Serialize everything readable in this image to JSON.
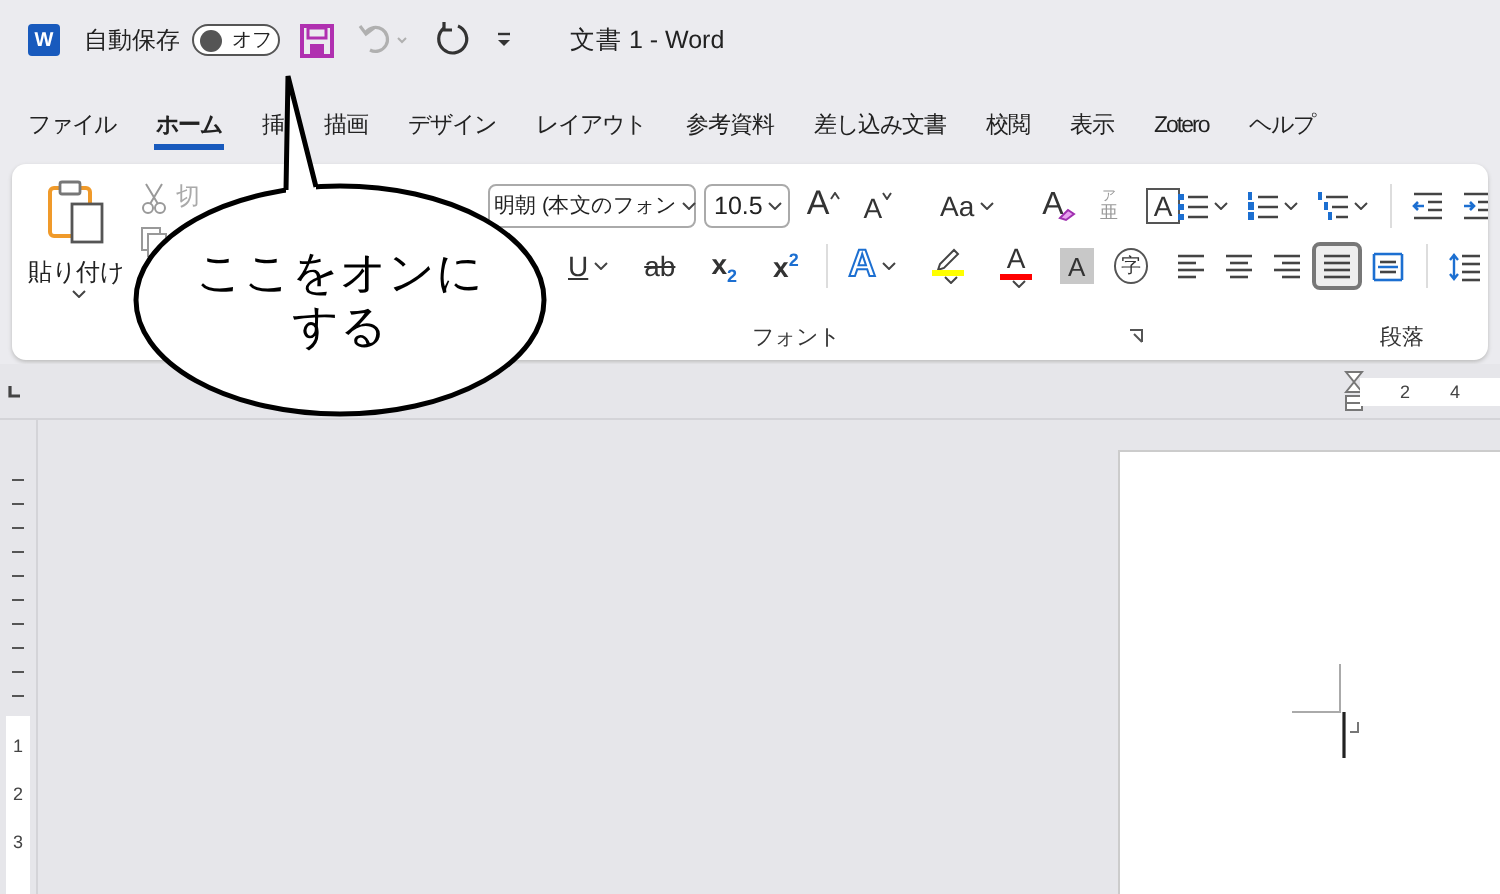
{
  "titlebar": {
    "app_letter": "W",
    "autosave_label": "自動保存",
    "autosave": {
      "on": false,
      "label": "オフ"
    },
    "quick_access": [
      {
        "kind": "save",
        "disabled": false
      },
      {
        "kind": "undo",
        "disabled": true
      },
      {
        "kind": "redo",
        "disabled": false
      },
      {
        "kind": "customize",
        "disabled": false
      }
    ],
    "title": "文書 1  -  Word"
  },
  "tabs": [
    {
      "label": "ファイル",
      "selected": false
    },
    {
      "label": "ホーム",
      "selected": true
    },
    {
      "label": "挿",
      "selected": false
    },
    {
      "label": "描画",
      "selected": false
    },
    {
      "label": "デザイン",
      "selected": false
    },
    {
      "label": "レイアウト",
      "selected": false
    },
    {
      "label": "参考資料",
      "selected": false
    },
    {
      "label": "差し込み文書",
      "selected": false
    },
    {
      "label": "校閲",
      "selected": false
    },
    {
      "label": "表示",
      "selected": false
    },
    {
      "label": "Zotero",
      "selected": false
    },
    {
      "label": "ヘルプ",
      "selected": false
    }
  ],
  "ribbon": {
    "clipboard": {
      "paste_label": "貼り付け",
      "cut_label": "切"
    },
    "font": {
      "font_name": "明朝 (本文のフォン",
      "font_size": "10.5",
      "row1": [
        [
          {
            "kind": "grow",
            "glyph": "A",
            "dropdown": false
          },
          {
            "kind": "shrink",
            "glyph": "A",
            "dropdown": false
          }
        ],
        [
          {
            "kind": "case",
            "glyph": "Aa",
            "dropdown": true
          }
        ],
        [
          {
            "kind": "clear",
            "glyph": "A",
            "dropdown": false
          },
          {
            "kind": "ruby",
            "glyph": "亜",
            "ruby": "ア",
            "dropdown": false
          },
          {
            "kind": "boxed",
            "glyph": "A",
            "dropdown": false
          }
        ]
      ],
      "row2": [
        [
          {
            "kind": "underline",
            "glyph": "U",
            "dropdown": true
          },
          {
            "kind": "strike",
            "glyph": "ab",
            "dropdown": false
          },
          {
            "kind": "sub",
            "glyph": "x$_{2}$",
            "dropdown": false
          },
          {
            "kind": "sup",
            "glyph": "x$^{2}$",
            "dropdown": false
          }
        ],
        [
          {
            "kind": "effects",
            "glyph": "A",
            "dropdown": true
          },
          {
            "kind": "highlight",
            "color": "#ffff00",
            "dropdown": true
          },
          {
            "kind": "fontcolor",
            "glyph": "A",
            "color": "#ff0000",
            "dropdown": true
          },
          {
            "kind": "shading",
            "glyph": "A",
            "dropdown": false
          },
          {
            "kind": "circled",
            "glyph": "字",
            "dropdown": false
          }
        ]
      ],
      "group_label": "フォント"
    },
    "paragraph": {
      "row1": [
        [
          {
            "kind": "bullets",
            "dropdown": true
          },
          {
            "kind": "numbering",
            "dropdown": true
          },
          {
            "kind": "multilevel",
            "dropdown": true
          }
        ],
        [
          {
            "kind": "outdent",
            "dropdown": false
          },
          {
            "kind": "indent",
            "dropdown": false
          }
        ]
      ],
      "row2": [
        [
          {
            "kind": "left",
            "selected": false
          },
          {
            "kind": "center",
            "selected": false
          },
          {
            "kind": "right",
            "selected": false
          },
          {
            "kind": "justify",
            "selected": true
          },
          {
            "kind": "distribute",
            "selected": false
          }
        ],
        [
          {
            "kind": "spacing",
            "selected": false
          }
        ]
      ],
      "group_label": "段落"
    }
  },
  "ruler": {
    "h_numbers": [
      "2",
      "4"
    ],
    "v_numbers": [
      "1",
      "2",
      "3"
    ]
  },
  "callout": {
    "text": "ここをオンにする"
  }
}
